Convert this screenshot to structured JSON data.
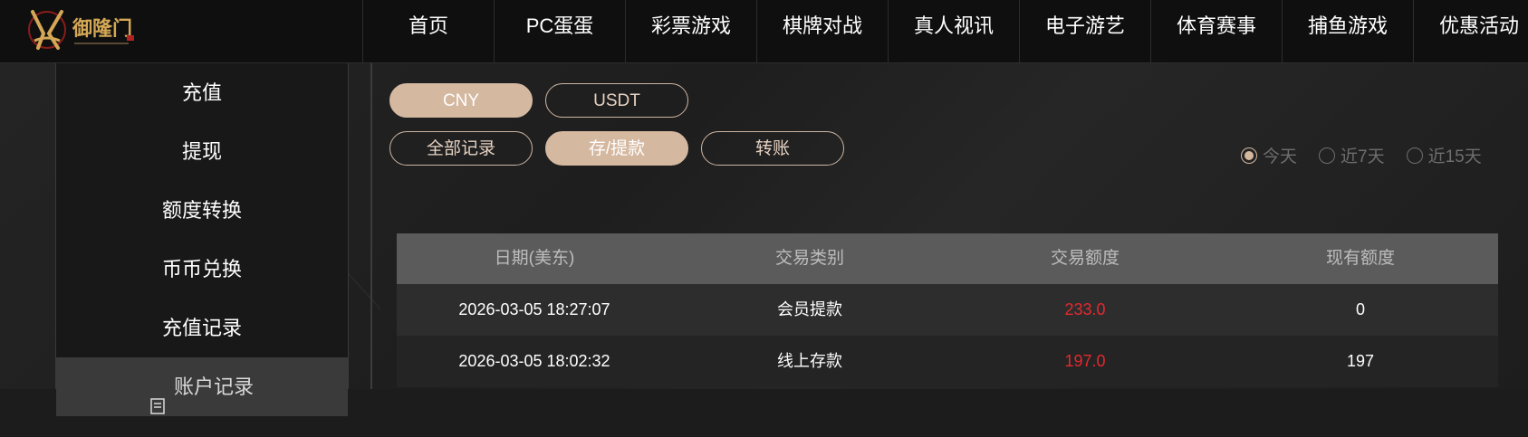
{
  "nav": {
    "items": [
      "首页",
      "PC蛋蛋",
      "彩票游戏",
      "棋牌对战",
      "真人视讯",
      "电子游艺",
      "体育赛事",
      "捕鱼游戏",
      "优惠活动"
    ]
  },
  "logo": {
    "text": "御隆门",
    "tagline": ""
  },
  "sidebar": {
    "items": [
      {
        "label": "充值"
      },
      {
        "label": "提现"
      },
      {
        "label": "额度转换"
      },
      {
        "label": "币币兑换"
      },
      {
        "label": "充值记录"
      },
      {
        "label": "账户记录",
        "icon": "document-icon"
      }
    ],
    "active_index": 5
  },
  "currency_tabs": {
    "cny": "CNY",
    "usdt": "USDT",
    "active": "CNY"
  },
  "type_tabs": {
    "all": "全部记录",
    "deposit_withdraw": "存/提款",
    "transfer": "转账",
    "active": "存/提款"
  },
  "date_filter": {
    "today": "今天",
    "last7": "近7天",
    "last15": "近15天",
    "selected": "今天"
  },
  "table": {
    "headers": [
      "日期(美东)",
      "交易类别",
      "交易额度",
      "现有额度"
    ],
    "rows": [
      [
        "2026-03-05 18:27:07",
        "会员提款",
        "233.0",
        "0"
      ],
      [
        "2026-03-05 18:02:32",
        "线上存款",
        "197.0",
        "197"
      ]
    ]
  },
  "colors": {
    "accent": "#d5b8a0",
    "amount": "#e3292f",
    "nav_bg": "#0f0f0f",
    "table_header_bg": "#5b5b5b"
  }
}
